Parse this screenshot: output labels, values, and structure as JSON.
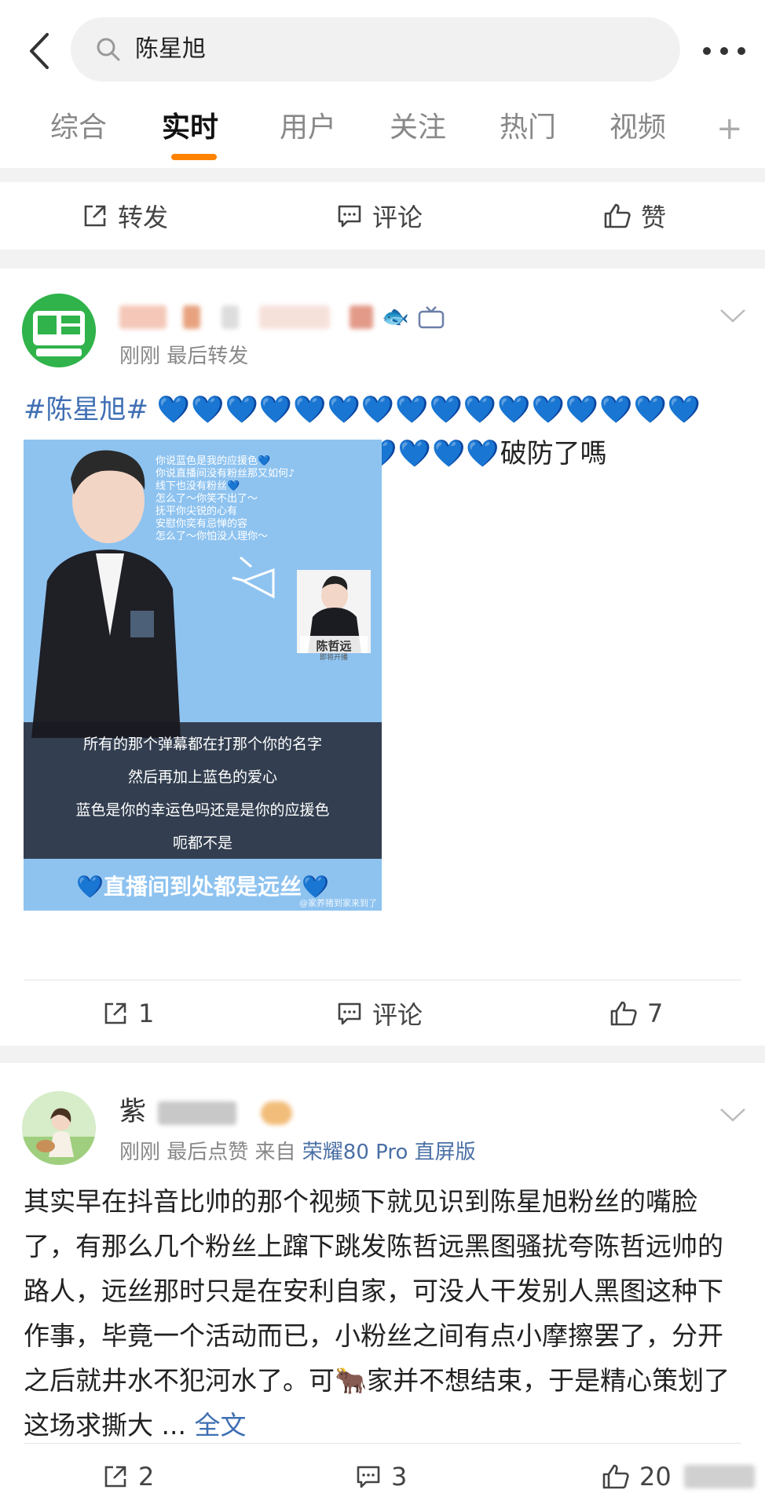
{
  "search": {
    "query": "陈星旭"
  },
  "tabs": [
    {
      "label": "综合"
    },
    {
      "label": "实时"
    },
    {
      "label": "用户"
    },
    {
      "label": "关注"
    },
    {
      "label": "热门"
    },
    {
      "label": "视频"
    }
  ],
  "tab_plus": "+",
  "top_actions": {
    "repost": "转发",
    "comment": "评论",
    "like": "赞"
  },
  "post1": {
    "username_tail": "",
    "meta": "刚刚 最后转发",
    "topic": "#陈星旭#",
    "hearts_line1": "💙💙💙💙💙💙💙💙💙💙💙💙💙💙💙💙",
    "hearts_line2": "💙💙💙💙💙💙💙💙💙💙💙💙💙💙",
    "text_tail": "破防了嗎",
    "image": {
      "poem": [
        "你说蓝色是我的应援色💙",
        "你说直播间没有粉丝那又如何♪",
        "线下也没有粉丝💙",
        "怎么了～你笑不出了～",
        "抚平你尖锐的心有",
        "安慰你奕有忌惮的容",
        "怎么了～你怕没人理你～"
      ],
      "name_tag": "陈哲远",
      "name_sub": "即将开播",
      "sub1": "所有的那个弹幕都在打那个你的名字",
      "sub2": "然后再加上蓝色的爱心",
      "sub3": "蓝色是你的幸运色吗还是是你的应援色",
      "sub4": "呃都不是",
      "bottom": "💙直播间到处都是远丝💙",
      "watermark": "@家养猪到家来到了"
    },
    "repost_count": "1",
    "comment_label": "评论",
    "like_count": "7"
  },
  "post2": {
    "username": "紫",
    "meta_prefix": "刚刚 最后点赞  来自",
    "meta_source": "荣耀80 Pro 直屏版",
    "text": "其实早在抖音比帅的那个视频下就见识到陈星旭粉丝的嘴脸了，有那么几个粉丝上蹿下跳发陈哲远黑图骚扰夸陈哲远帅的路人，远丝那时只是在安利自家，可没人干发别人黑图这种下作事，毕竟一个活动而已，小粉丝之间有点小摩擦罢了，分开之后就井水不犯河水了。可🐂家并不想结束，于是精心策划了这场求撕大 ...",
    "full_text_link": "全文",
    "repost_count": "2",
    "comment_count": "3",
    "like_count": "20"
  },
  "colors": {
    "accent": "#ff8200",
    "link": "#3f6fb3",
    "heart": "#1565c0",
    "source": "#4a6fa5"
  }
}
